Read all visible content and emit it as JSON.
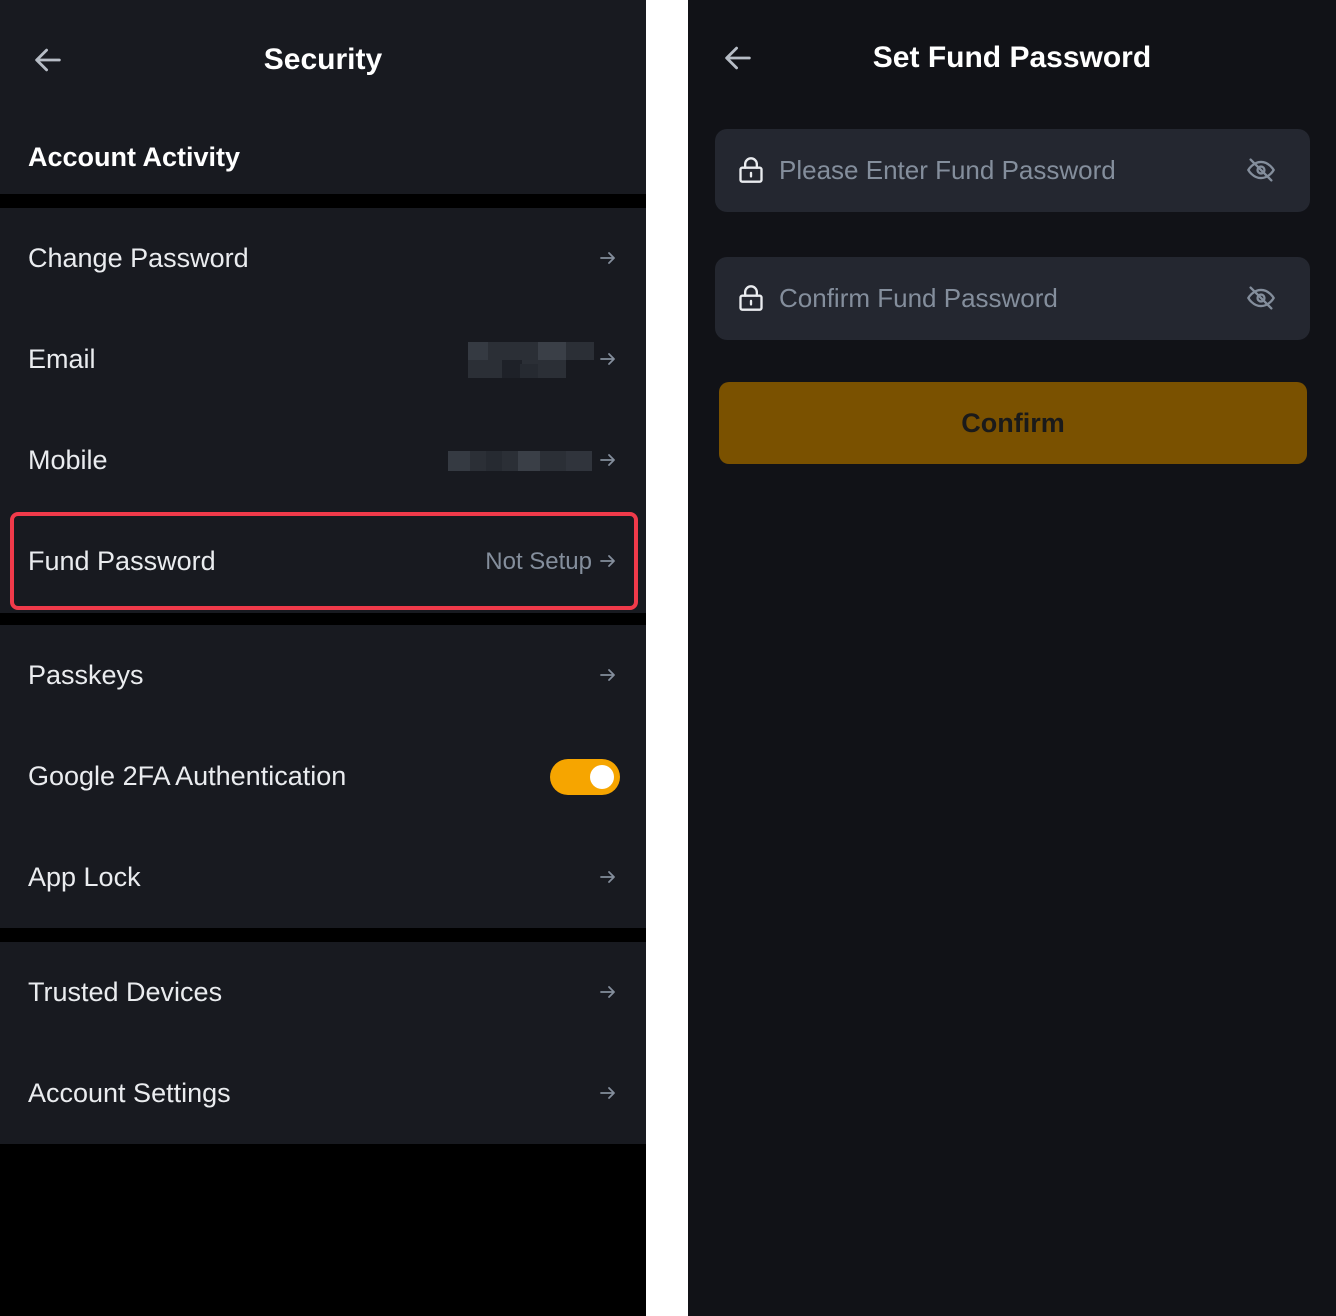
{
  "security_screen": {
    "title": "Security",
    "section_title": "Account Activity",
    "items": [
      {
        "label": "Change Password"
      },
      {
        "label": "Email"
      },
      {
        "label": "Mobile"
      },
      {
        "label": "Fund Password",
        "value": "Not Setup"
      },
      {
        "label": "Passkeys"
      },
      {
        "label": "Google 2FA Authentication",
        "toggle_on": true
      },
      {
        "label": "App Lock"
      },
      {
        "label": "Trusted Devices"
      },
      {
        "label": "Account Settings"
      }
    ],
    "toggle_color": "#f6a500",
    "highlight_color": "#f03a4a"
  },
  "fund_password_screen": {
    "title": "Set Fund Password",
    "password_placeholder": "Please Enter Fund Password",
    "confirm_placeholder": "Confirm Fund Password",
    "confirm_button": "Confirm",
    "button_color": "#7a5100"
  },
  "icons": [
    "back-arrow-icon",
    "chevron-right-icon",
    "lock-icon",
    "eye-off-icon"
  ]
}
